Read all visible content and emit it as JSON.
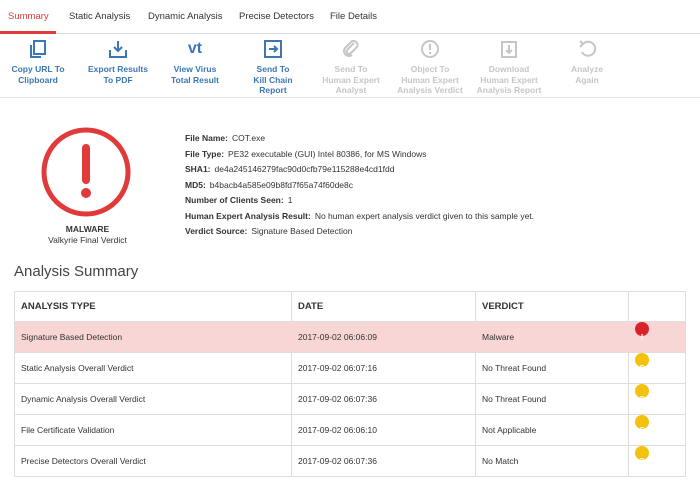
{
  "tabs": [
    {
      "label": "Summary"
    },
    {
      "label": "Static Analysis"
    },
    {
      "label": "Dynamic Analysis"
    },
    {
      "label": "Precise Detectors"
    },
    {
      "label": "File Details"
    }
  ],
  "toolbar": [
    {
      "label": "Copy URL To\nClipboard",
      "icon": "copy-icon",
      "enabled": true
    },
    {
      "label": "Export Results\nTo PDF",
      "icon": "export-icon",
      "enabled": true
    },
    {
      "label": "View Virus\nTotal Result",
      "icon": "vt-icon",
      "glyph": "vt",
      "enabled": true
    },
    {
      "label": "Send To\nKill Chain\nReport",
      "icon": "send-arrow-icon",
      "enabled": true
    },
    {
      "label": "Send To\nHuman Expert\nAnalyst",
      "icon": "paperclip-icon",
      "enabled": false
    },
    {
      "label": "Object To\nHuman Expert\nAnalysis Verdict",
      "icon": "exclamation-circle-icon",
      "enabled": false
    },
    {
      "label": "Download\nHuman Expert\nAnalysis Report",
      "icon": "download-icon",
      "enabled": false
    },
    {
      "label": "Analyze\nAgain",
      "icon": "refresh-icon",
      "enabled": false
    }
  ],
  "verdict": {
    "title": "MALWARE",
    "subtitle": "Valkyrie Final Verdict",
    "icon": "exclamation-circle-icon",
    "color": "#e03a3a"
  },
  "file_info": [
    {
      "key": "File Name:",
      "value": "COT.exe"
    },
    {
      "key": "File Type:",
      "value": "PE32 executable (GUI) Intel 80386, for MS Windows"
    },
    {
      "key": "SHA1:",
      "value": "de4a245146279fac90d0cfb79e115288e4cd1fdd"
    },
    {
      "key": "MD5:",
      "value": "b4bacb4a585e09b8fd7f65a74f60de8c"
    },
    {
      "key": "Number of Clients Seen:",
      "value": "1"
    },
    {
      "key": "Human Expert Analysis Result:",
      "value": "No human expert analysis verdict given to this sample yet."
    },
    {
      "key": "Verdict Source:",
      "value": "Signature Based Detection"
    }
  ],
  "analysis_summary": {
    "title": "Analysis Summary",
    "columns": [
      "ANALYSIS TYPE",
      "DATE",
      "VERDICT"
    ],
    "rows": [
      {
        "type": "Signature Based Detection",
        "date": "2017-09-02 06:06:09",
        "verdict": "Malware",
        "status": "danger",
        "glyph": "!",
        "highlight": true
      },
      {
        "type": "Static Analysis Overall Verdict",
        "date": "2017-09-02 06:07:16",
        "verdict": "No Threat Found",
        "status": "warning",
        "glyph": "?",
        "highlight": false
      },
      {
        "type": "Dynamic Analysis Overall Verdict",
        "date": "2017-09-02 06:07:36",
        "verdict": "No Threat Found",
        "status": "warning",
        "glyph": "?",
        "highlight": false
      },
      {
        "type": "File Certificate Validation",
        "date": "2017-09-02 06:06:10",
        "verdict": "Not Applicable",
        "status": "warning",
        "glyph": "?",
        "highlight": false
      },
      {
        "type": "Precise Detectors Overall Verdict",
        "date": "2017-09-02 06:07:36",
        "verdict": "No Match",
        "status": "warning",
        "glyph": "?",
        "highlight": false
      }
    ]
  },
  "colors": {
    "accent": "#e03a3a",
    "link": "#3a77b4",
    "disabled": "#c6c6c6",
    "alert_row": "#f9d6d6",
    "warning": "#f2c20f"
  }
}
